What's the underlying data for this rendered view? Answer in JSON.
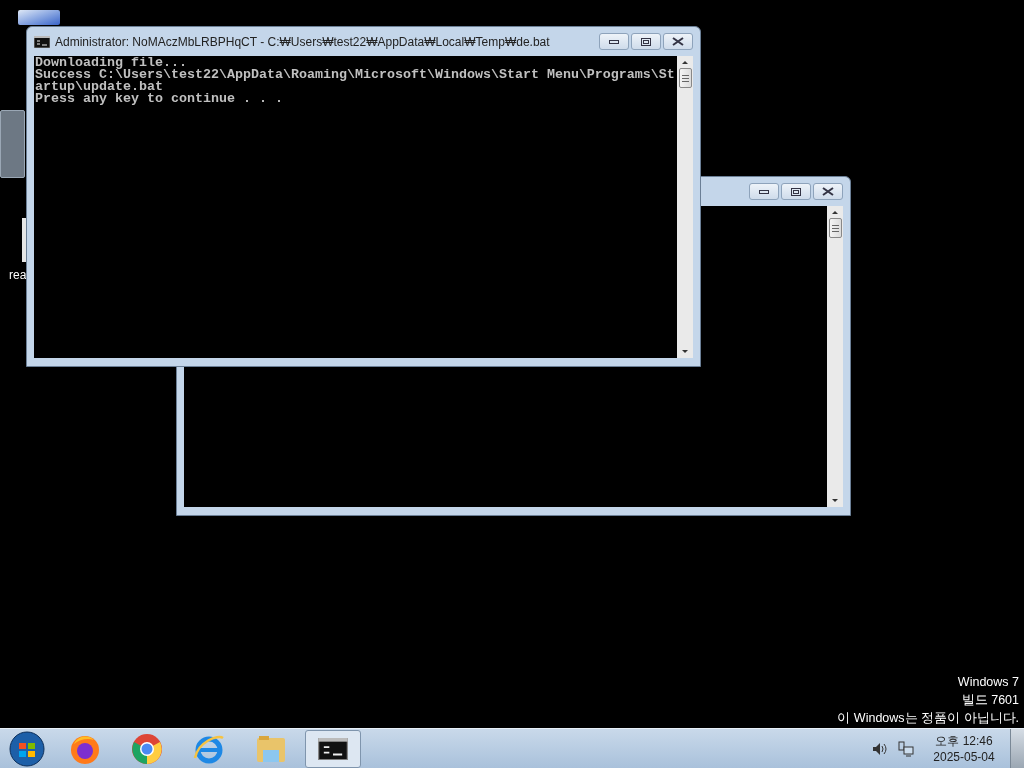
{
  "desktop_icons": [
    {
      "label": "rea"
    }
  ],
  "windows": [
    {
      "kind": "console-back"
    },
    {
      "kind": "console",
      "title": "Administrator: NoMAczMbLRBPHqCT - C:₩Users₩test22₩AppData₩Local₩Temp₩de.bat",
      "lines": [
        "Downloading file...",
        "Success C:\\Users\\test22\\AppData\\Roaming\\Microsoft\\Windows\\Start Menu\\Programs\\St",
        "artup\\update.bat",
        "Press any key to continue . . ."
      ]
    }
  ],
  "watermark": [
    "Windows 7",
    "빌드 7601",
    "이 Windows는 정품이 아닙니다."
  ],
  "taskbar": {
    "items": [
      {
        "kind": "firefox",
        "selected": false
      },
      {
        "kind": "chrome",
        "selected": false
      },
      {
        "kind": "ie",
        "selected": false
      },
      {
        "kind": "folder",
        "selected": false
      },
      {
        "kind": "console",
        "selected": true
      }
    ],
    "time": "오후 12:46",
    "date": "2025-05-04"
  }
}
